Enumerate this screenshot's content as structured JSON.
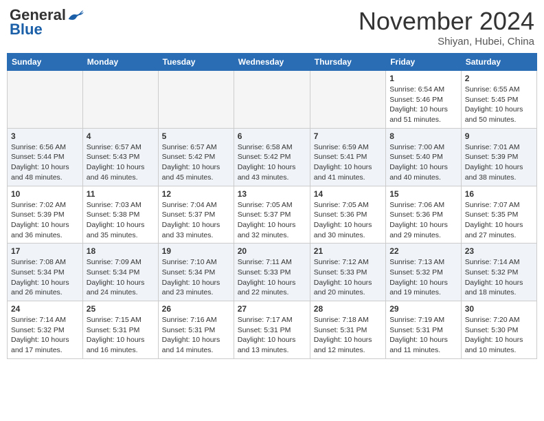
{
  "header": {
    "logo_general": "General",
    "logo_blue": "Blue",
    "month_title": "November 2024",
    "location": "Shiyan, Hubei, China"
  },
  "weekdays": [
    "Sunday",
    "Monday",
    "Tuesday",
    "Wednesday",
    "Thursday",
    "Friday",
    "Saturday"
  ],
  "weeks": [
    {
      "row_class": "row-1",
      "days": [
        {
          "num": "",
          "info": "",
          "empty": true
        },
        {
          "num": "",
          "info": "",
          "empty": true
        },
        {
          "num": "",
          "info": "",
          "empty": true
        },
        {
          "num": "",
          "info": "",
          "empty": true
        },
        {
          "num": "",
          "info": "",
          "empty": true
        },
        {
          "num": "1",
          "info": "Sunrise: 6:54 AM\nSunset: 5:46 PM\nDaylight: 10 hours\nand 51 minutes.",
          "empty": false
        },
        {
          "num": "2",
          "info": "Sunrise: 6:55 AM\nSunset: 5:45 PM\nDaylight: 10 hours\nand 50 minutes.",
          "empty": false
        }
      ]
    },
    {
      "row_class": "row-2",
      "days": [
        {
          "num": "3",
          "info": "Sunrise: 6:56 AM\nSunset: 5:44 PM\nDaylight: 10 hours\nand 48 minutes.",
          "empty": false
        },
        {
          "num": "4",
          "info": "Sunrise: 6:57 AM\nSunset: 5:43 PM\nDaylight: 10 hours\nand 46 minutes.",
          "empty": false
        },
        {
          "num": "5",
          "info": "Sunrise: 6:57 AM\nSunset: 5:42 PM\nDaylight: 10 hours\nand 45 minutes.",
          "empty": false
        },
        {
          "num": "6",
          "info": "Sunrise: 6:58 AM\nSunset: 5:42 PM\nDaylight: 10 hours\nand 43 minutes.",
          "empty": false
        },
        {
          "num": "7",
          "info": "Sunrise: 6:59 AM\nSunset: 5:41 PM\nDaylight: 10 hours\nand 41 minutes.",
          "empty": false
        },
        {
          "num": "8",
          "info": "Sunrise: 7:00 AM\nSunset: 5:40 PM\nDaylight: 10 hours\nand 40 minutes.",
          "empty": false
        },
        {
          "num": "9",
          "info": "Sunrise: 7:01 AM\nSunset: 5:39 PM\nDaylight: 10 hours\nand 38 minutes.",
          "empty": false
        }
      ]
    },
    {
      "row_class": "row-3",
      "days": [
        {
          "num": "10",
          "info": "Sunrise: 7:02 AM\nSunset: 5:39 PM\nDaylight: 10 hours\nand 36 minutes.",
          "empty": false
        },
        {
          "num": "11",
          "info": "Sunrise: 7:03 AM\nSunset: 5:38 PM\nDaylight: 10 hours\nand 35 minutes.",
          "empty": false
        },
        {
          "num": "12",
          "info": "Sunrise: 7:04 AM\nSunset: 5:37 PM\nDaylight: 10 hours\nand 33 minutes.",
          "empty": false
        },
        {
          "num": "13",
          "info": "Sunrise: 7:05 AM\nSunset: 5:37 PM\nDaylight: 10 hours\nand 32 minutes.",
          "empty": false
        },
        {
          "num": "14",
          "info": "Sunrise: 7:05 AM\nSunset: 5:36 PM\nDaylight: 10 hours\nand 30 minutes.",
          "empty": false
        },
        {
          "num": "15",
          "info": "Sunrise: 7:06 AM\nSunset: 5:36 PM\nDaylight: 10 hours\nand 29 minutes.",
          "empty": false
        },
        {
          "num": "16",
          "info": "Sunrise: 7:07 AM\nSunset: 5:35 PM\nDaylight: 10 hours\nand 27 minutes.",
          "empty": false
        }
      ]
    },
    {
      "row_class": "row-4",
      "days": [
        {
          "num": "17",
          "info": "Sunrise: 7:08 AM\nSunset: 5:34 PM\nDaylight: 10 hours\nand 26 minutes.",
          "empty": false
        },
        {
          "num": "18",
          "info": "Sunrise: 7:09 AM\nSunset: 5:34 PM\nDaylight: 10 hours\nand 24 minutes.",
          "empty": false
        },
        {
          "num": "19",
          "info": "Sunrise: 7:10 AM\nSunset: 5:34 PM\nDaylight: 10 hours\nand 23 minutes.",
          "empty": false
        },
        {
          "num": "20",
          "info": "Sunrise: 7:11 AM\nSunset: 5:33 PM\nDaylight: 10 hours\nand 22 minutes.",
          "empty": false
        },
        {
          "num": "21",
          "info": "Sunrise: 7:12 AM\nSunset: 5:33 PM\nDaylight: 10 hours\nand 20 minutes.",
          "empty": false
        },
        {
          "num": "22",
          "info": "Sunrise: 7:13 AM\nSunset: 5:32 PM\nDaylight: 10 hours\nand 19 minutes.",
          "empty": false
        },
        {
          "num": "23",
          "info": "Sunrise: 7:14 AM\nSunset: 5:32 PM\nDaylight: 10 hours\nand 18 minutes.",
          "empty": false
        }
      ]
    },
    {
      "row_class": "row-5",
      "days": [
        {
          "num": "24",
          "info": "Sunrise: 7:14 AM\nSunset: 5:32 PM\nDaylight: 10 hours\nand 17 minutes.",
          "empty": false
        },
        {
          "num": "25",
          "info": "Sunrise: 7:15 AM\nSunset: 5:31 PM\nDaylight: 10 hours\nand 16 minutes.",
          "empty": false
        },
        {
          "num": "26",
          "info": "Sunrise: 7:16 AM\nSunset: 5:31 PM\nDaylight: 10 hours\nand 14 minutes.",
          "empty": false
        },
        {
          "num": "27",
          "info": "Sunrise: 7:17 AM\nSunset: 5:31 PM\nDaylight: 10 hours\nand 13 minutes.",
          "empty": false
        },
        {
          "num": "28",
          "info": "Sunrise: 7:18 AM\nSunset: 5:31 PM\nDaylight: 10 hours\nand 12 minutes.",
          "empty": false
        },
        {
          "num": "29",
          "info": "Sunrise: 7:19 AM\nSunset: 5:31 PM\nDaylight: 10 hours\nand 11 minutes.",
          "empty": false
        },
        {
          "num": "30",
          "info": "Sunrise: 7:20 AM\nSunset: 5:30 PM\nDaylight: 10 hours\nand 10 minutes.",
          "empty": false
        }
      ]
    }
  ]
}
